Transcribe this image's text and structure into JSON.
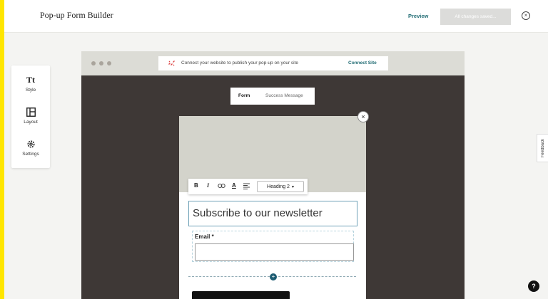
{
  "header": {
    "title": "Pop-up Form Builder",
    "preview_label": "Preview",
    "saved_label": "All changes saved..."
  },
  "tools": [
    {
      "label": "Style",
      "icon": "text-style-icon",
      "glyph": "Tt"
    },
    {
      "label": "Layout",
      "icon": "layout-icon"
    },
    {
      "label": "Settings",
      "icon": "gear-icon"
    }
  ],
  "browser": {
    "connect_message": "Connect your website to publish your pop-up on your site",
    "connect_link": "Connect Site"
  },
  "tabs": {
    "form": "Form",
    "success": "Success Message"
  },
  "toolbar": {
    "bold": "B",
    "italic": "I",
    "text_color": "A",
    "heading_select": "Heading 2"
  },
  "popup": {
    "heading": "Subscribe to our newsletter",
    "email_label": "Email *",
    "email_value": ""
  },
  "side": {
    "feedback": "Feedback",
    "help": "?"
  },
  "colors": {
    "accent_teal": "#1f6b73",
    "brand_yellow": "#ffe600",
    "canvas_dark": "#3e3836"
  }
}
